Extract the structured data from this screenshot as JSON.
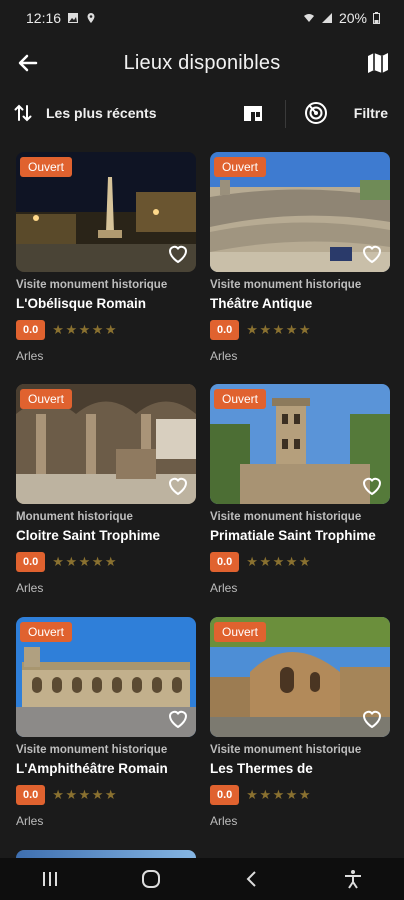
{
  "status": {
    "time": "12:16",
    "battery": "20%"
  },
  "header": {
    "title": "Lieux disponibles"
  },
  "toolbar": {
    "sort_label": "Les plus récents",
    "filter_label": "Filtre"
  },
  "places": [
    {
      "badge": "Ouvert",
      "category": "Visite monument historique",
      "name": "L'Obélisque Romain",
      "score": "0.0",
      "stars": "★★★★★",
      "city": "Arles"
    },
    {
      "badge": "Ouvert",
      "category": "Visite monument historique",
      "name": "Théâtre Antique",
      "score": "0.0",
      "stars": "★★★★★",
      "city": "Arles"
    },
    {
      "badge": "Ouvert",
      "category": "Monument historique",
      "name": "Cloitre Saint Trophime",
      "score": "0.0",
      "stars": "★★★★★",
      "city": "Arles"
    },
    {
      "badge": "Ouvert",
      "category": "Visite monument historique",
      "name": "Primatiale Saint Trophime",
      "score": "0.0",
      "stars": "★★★★★",
      "city": "Arles"
    },
    {
      "badge": "Ouvert",
      "category": "Visite monument historique",
      "name": "L'Amphithéâtre Romain",
      "score": "0.0",
      "stars": "★★★★★",
      "city": "Arles"
    },
    {
      "badge": "Ouvert",
      "category": "Visite monument historique",
      "name": "Les Thermes de",
      "score": "0.0",
      "stars": "★★★★★",
      "city": "Arles"
    }
  ],
  "icons": {
    "back": "arrow-left-icon",
    "map": "map-icon",
    "sort": "sort-arrows-icon",
    "grid": "grid-view-icon",
    "radar": "radar-icon",
    "heart": "heart-outline-icon"
  },
  "colors": {
    "accent": "#e0622f",
    "background": "#1b1b1b",
    "star": "#8a7130"
  }
}
